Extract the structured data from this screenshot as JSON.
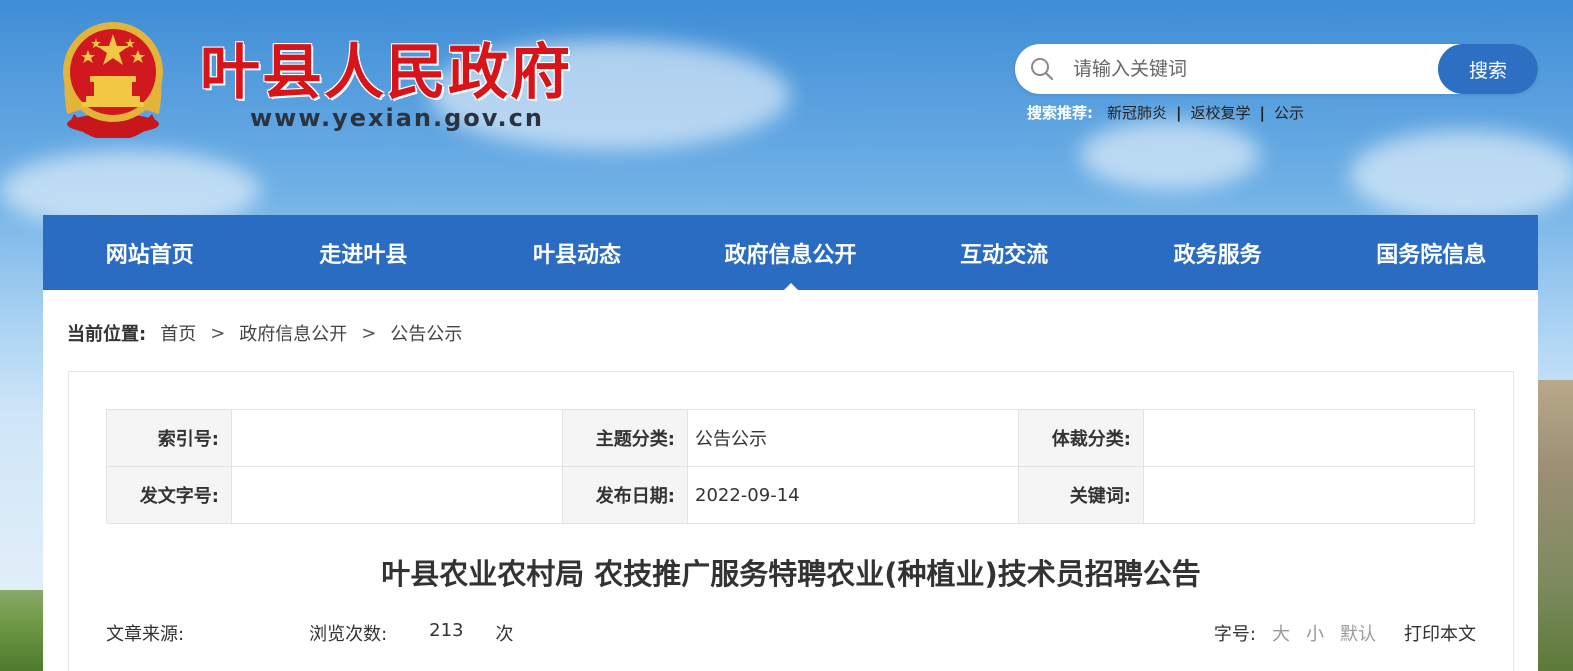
{
  "header": {
    "site_name": "叶县人民政府",
    "site_url": "www.yexian.gov.cn"
  },
  "search": {
    "placeholder": "请输入关键词",
    "button_label": "搜索",
    "rec_label": "搜索推荐:",
    "rec_items": [
      "新冠肺炎",
      "返校复学",
      "公示"
    ],
    "separator": "|"
  },
  "nav": {
    "items": [
      "网站首页",
      "走进叶县",
      "叶县动态",
      "政府信息公开",
      "互动交流",
      "政务服务",
      "国务院信息"
    ],
    "active_index": 3
  },
  "breadcrumb": {
    "label": "当前位置:",
    "items": [
      "首页",
      "政府信息公开",
      "公告公示"
    ],
    "arrow": ">"
  },
  "info": {
    "index_no_label": "索引号:",
    "index_no": "",
    "topic_label": "主题分类:",
    "topic": "公告公示",
    "genre_label": "体裁分类:",
    "genre": "",
    "doc_no_label": "发文字号:",
    "doc_no": "",
    "date_label": "发布日期:",
    "date": "2022-09-14",
    "keyword_label": "关键词:",
    "keyword": ""
  },
  "article": {
    "title": "叶县农业农村局 农技推广服务特聘农业(种植业)技术员招聘公告",
    "source_label": "文章来源:",
    "source": "",
    "views_label": "浏览次数:",
    "views": "213",
    "views_unit": "次"
  },
  "tools": {
    "font_label": "字号:",
    "font_large": "大",
    "font_small": "小",
    "font_default": "默认",
    "print_label": "打印本文"
  },
  "colors": {
    "nav_bg": "#2b6cc3",
    "site_name": "#d7141a",
    "search_btn": "#2d6fc2"
  }
}
